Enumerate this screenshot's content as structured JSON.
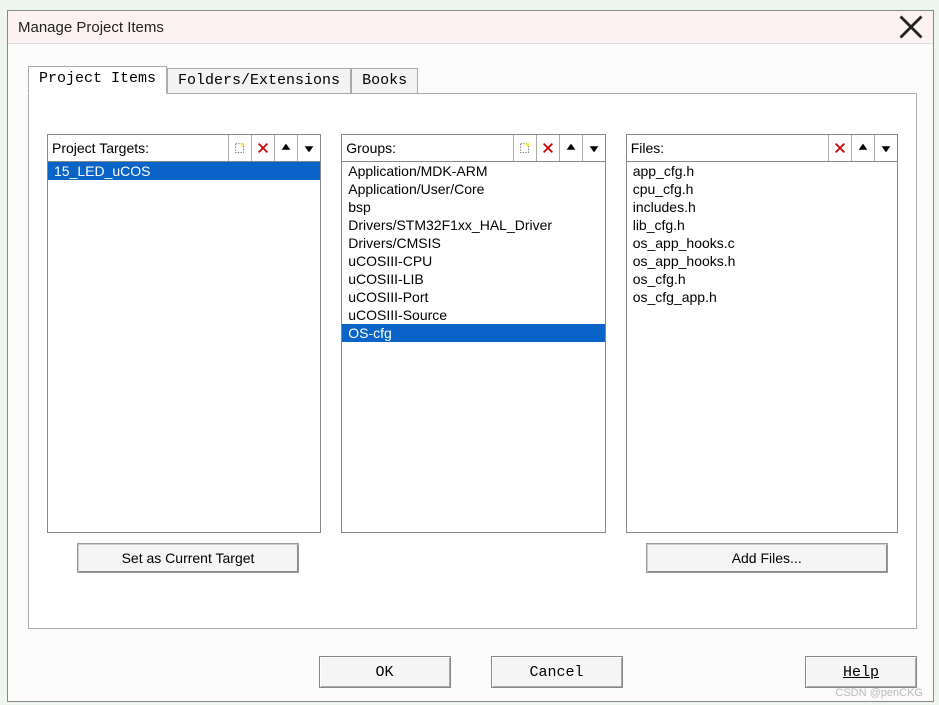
{
  "window": {
    "title": "Manage Project Items"
  },
  "tabs": {
    "items": [
      {
        "label": "Project Items",
        "active": true
      },
      {
        "label": "Folders/Extensions",
        "active": false
      },
      {
        "label": "Books",
        "active": false
      }
    ]
  },
  "columns": {
    "targets": {
      "label": "Project Targets:",
      "toolbar": {
        "new": "new-icon",
        "delete": "delete-icon",
        "up": "up-icon",
        "down": "down-icon"
      },
      "items": [
        "15_LED_uCOS"
      ],
      "selected_index": 0,
      "below_button": "Set as Current Target"
    },
    "groups": {
      "label": "Groups:",
      "toolbar": {
        "new": "new-icon",
        "delete": "delete-icon",
        "up": "up-icon",
        "down": "down-icon"
      },
      "items": [
        "Application/MDK-ARM",
        "Application/User/Core",
        "bsp",
        "Drivers/STM32F1xx_HAL_Driver",
        "Drivers/CMSIS",
        "uCOSIII-CPU",
        "uCOSIII-LIB",
        "uCOSIII-Port",
        "uCOSIII-Source",
        "OS-cfg"
      ],
      "selected_index": 9
    },
    "files": {
      "label": "Files:",
      "toolbar": {
        "delete": "delete-icon",
        "up": "up-icon",
        "down": "down-icon"
      },
      "items": [
        "app_cfg.h",
        "cpu_cfg.h",
        "includes.h",
        "lib_cfg.h",
        "os_app_hooks.c",
        "os_app_hooks.h",
        "os_cfg.h",
        "os_cfg_app.h"
      ],
      "selected_index": -1,
      "below_button": "Add Files..."
    }
  },
  "buttons": {
    "ok": "OK",
    "cancel": "Cancel",
    "help": "Help"
  },
  "watermark": "CSDN @penCKG"
}
